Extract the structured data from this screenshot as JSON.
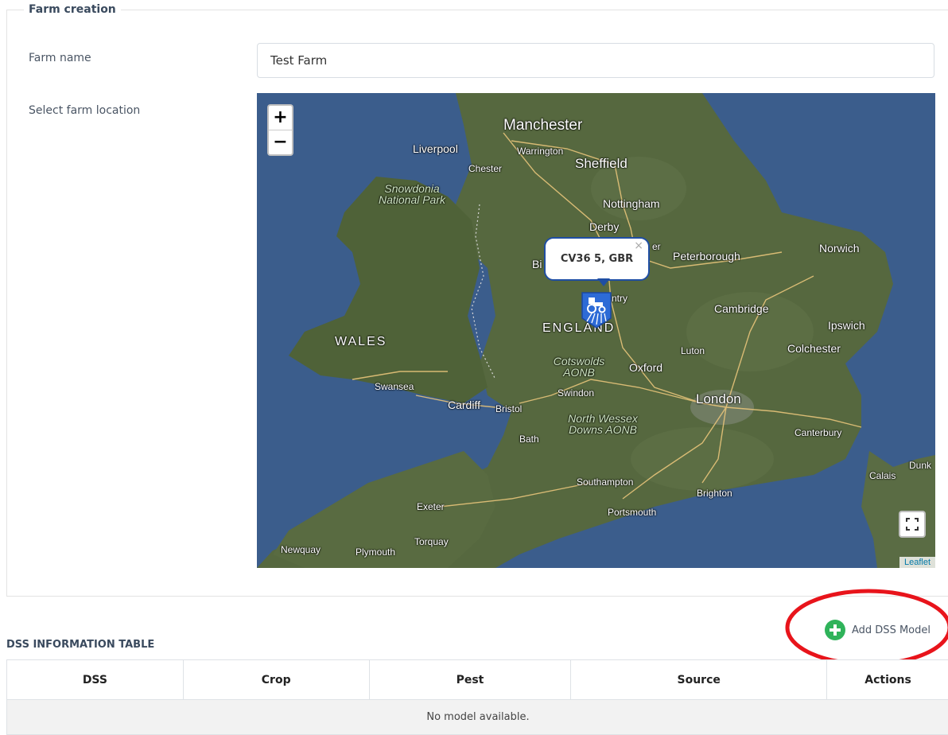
{
  "form": {
    "legend": "Farm creation",
    "farm_name_label": "Farm name",
    "farm_name_value": "Test Farm",
    "location_label": "Select farm location"
  },
  "map": {
    "zoom_in": "+",
    "zoom_out": "−",
    "popup_text": "CV36 5, GBR",
    "popup_close": "×",
    "attribution": "Leaflet",
    "marker_icon": "tractor-icon",
    "labels": {
      "manchester": "Manchester",
      "liverpool": "Liverpool",
      "warrington": "Warrington",
      "chester": "Chester",
      "sheffield": "Sheffield",
      "snowdonia": "Snowdonia National Park",
      "nottingham": "Nottingham",
      "derby": "Derby",
      "peterborough": "Peterborough",
      "norwich": "Norwich",
      "cambridge": "Cambridge",
      "ipswich": "Ipswich",
      "colchester": "Colchester",
      "luton": "Luton",
      "wales": "WALES",
      "england": "ENGLAND",
      "cotswolds": "Cotswolds AONB",
      "oxford": "Oxford",
      "swansea": "Swansea",
      "swindon": "Swindon",
      "london": "London",
      "cardiff": "Cardiff",
      "bristol": "Bristol",
      "north_wessex": "North Wessex Downs AONB",
      "bath": "Bath",
      "canterbury": "Canterbury",
      "southampton": "Southampton",
      "brighton": "Brighton",
      "portsmouth": "Portsmouth",
      "exeter": "Exeter",
      "torquay": "Torquay",
      "newquay": "Newquay",
      "plymouth": "Plymouth",
      "calais": "Calais",
      "dunkirk": "Dunk",
      "bi": "Bi",
      "ntry": "ntry",
      "er": "er"
    }
  },
  "actions": {
    "add_model_label": "Add DSS Model",
    "highlight_color": "#e8141b"
  },
  "table": {
    "title": "DSS INFORMATION TABLE",
    "headers": [
      "DSS",
      "Crop",
      "Pest",
      "Source",
      "Actions"
    ],
    "empty_message": "No model available."
  }
}
